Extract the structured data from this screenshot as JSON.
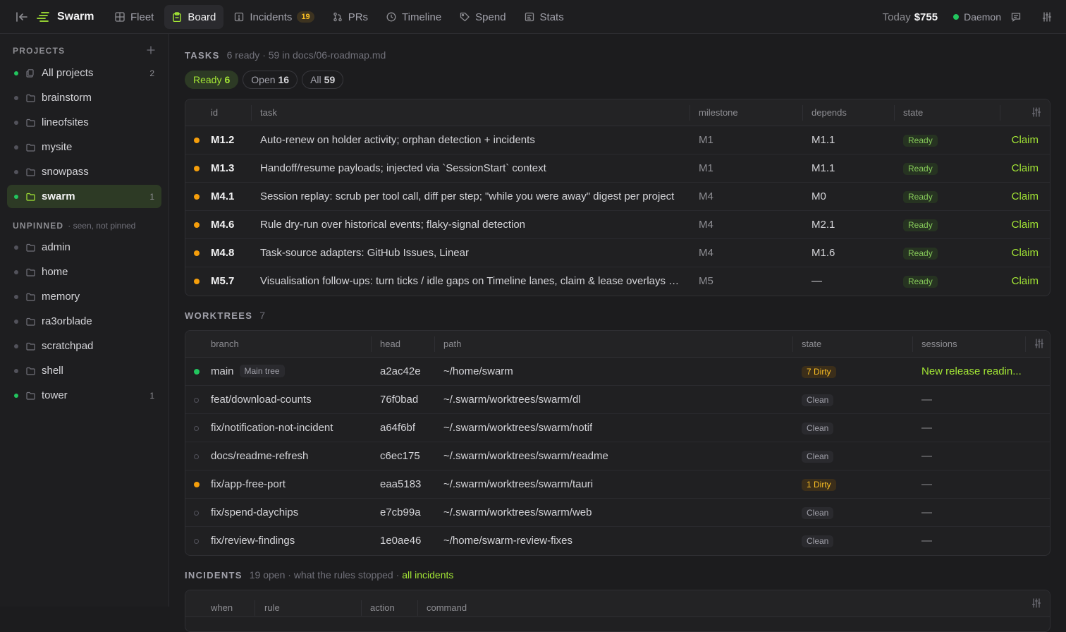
{
  "app": {
    "name": "Swarm"
  },
  "nav": [
    {
      "label": "Fleet",
      "icon": "grid-icon"
    },
    {
      "label": "Board",
      "icon": "clipboard-icon",
      "active": true
    },
    {
      "label": "Incidents",
      "icon": "alert-square-icon",
      "badge": "19"
    },
    {
      "label": "PRs",
      "icon": "pull-request-icon"
    },
    {
      "label": "Timeline",
      "icon": "clock-icon"
    },
    {
      "label": "Spend",
      "icon": "tag-icon"
    },
    {
      "label": "Stats",
      "icon": "stats-icon"
    }
  ],
  "topbar": {
    "today_label": "Today",
    "today_value": "$755",
    "daemon_label": "Daemon",
    "daemon_color": "#22c55e"
  },
  "sidebar": {
    "projects_title": "PROJECTS",
    "projects": [
      {
        "name": "All projects",
        "count": "2",
        "status": "green"
      },
      {
        "name": "brainstorm",
        "count": "",
        "status": "gray"
      },
      {
        "name": "lineofsites",
        "count": "",
        "status": "gray"
      },
      {
        "name": "mysite",
        "count": "",
        "status": "gray"
      },
      {
        "name": "snowpass",
        "count": "",
        "status": "gray"
      },
      {
        "name": "swarm",
        "count": "1",
        "status": "green",
        "active": true
      }
    ],
    "unpinned_title": "UNPINNED",
    "unpinned_sub": "· seen, not pinned",
    "unpinned": [
      {
        "name": "admin",
        "count": "",
        "status": "gray"
      },
      {
        "name": "home",
        "count": "",
        "status": "gray"
      },
      {
        "name": "memory",
        "count": "",
        "status": "gray"
      },
      {
        "name": "ra3orblade",
        "count": "",
        "status": "gray"
      },
      {
        "name": "scratchpad",
        "count": "",
        "status": "gray"
      },
      {
        "name": "shell",
        "count": "",
        "status": "gray"
      },
      {
        "name": "tower",
        "count": "1",
        "status": "green"
      }
    ]
  },
  "tasks": {
    "title": "TASKS",
    "subtitle": "6 ready · 59 in docs/06-roadmap.md",
    "filters": [
      {
        "label": "Ready",
        "count": "6",
        "active": true
      },
      {
        "label": "Open",
        "count": "16"
      },
      {
        "label": "All",
        "count": "59"
      }
    ],
    "columns": {
      "id": "id",
      "task": "task",
      "milestone": "milestone",
      "depends": "depends",
      "state": "state"
    },
    "rows": [
      {
        "id": "M1.2",
        "task": "Auto-renew on holder activity; orphan detection + incidents",
        "milestone": "M1",
        "depends": "M1.1",
        "state": "Ready",
        "action": "Claim"
      },
      {
        "id": "M1.3",
        "task": "Handoff/resume payloads; injected via `SessionStart` context",
        "milestone": "M1",
        "depends": "M1.1",
        "state": "Ready",
        "action": "Claim"
      },
      {
        "id": "M4.1",
        "task": "Session replay: scrub per tool call, diff per step; \"while you were away\" digest per project",
        "milestone": "M4",
        "depends": "M0",
        "state": "Ready",
        "action": "Claim"
      },
      {
        "id": "M4.6",
        "task": "Rule dry-run over historical events; flaky-signal detection",
        "milestone": "M4",
        "depends": "M2.1",
        "state": "Ready",
        "action": "Claim"
      },
      {
        "id": "M4.8",
        "task": "Task-source adapters: GitHub Issues, Linear",
        "milestone": "M4",
        "depends": "M1.6",
        "state": "Ready",
        "action": "Claim"
      },
      {
        "id": "M5.7",
        "task": "Visualisation follow-ups: turn ticks / idle gaps on Timeline lanes, claim & lease overlays onc...",
        "milestone": "M5",
        "depends": "—",
        "state": "Ready",
        "action": "Claim"
      }
    ]
  },
  "worktrees": {
    "title": "WORKTREES",
    "subtitle": "7",
    "columns": {
      "branch": "branch",
      "head": "head",
      "path": "path",
      "state": "state",
      "sessions": "sessions"
    },
    "rows": [
      {
        "branch": "main",
        "tag": "Main tree",
        "head": "a2ac42e",
        "path": "~/home/swarm",
        "state": "7 Dirty",
        "state_kind": "dirty",
        "sessions": "New release readin...",
        "dot": "green"
      },
      {
        "branch": "feat/download-counts",
        "tag": "",
        "head": "76f0bad",
        "path": "~/.swarm/worktrees/swarm/dl",
        "state": "Clean",
        "state_kind": "clean",
        "sessions": "—",
        "dot": "hollow"
      },
      {
        "branch": "fix/notification-not-incident",
        "tag": "",
        "head": "a64f6bf",
        "path": "~/.swarm/worktrees/swarm/notif",
        "state": "Clean",
        "state_kind": "clean",
        "sessions": "—",
        "dot": "hollow"
      },
      {
        "branch": "docs/readme-refresh",
        "tag": "",
        "head": "c6ec175",
        "path": "~/.swarm/worktrees/swarm/readme",
        "state": "Clean",
        "state_kind": "clean",
        "sessions": "—",
        "dot": "hollow"
      },
      {
        "branch": "fix/app-free-port",
        "tag": "",
        "head": "eaa5183",
        "path": "~/.swarm/worktrees/swarm/tauri",
        "state": "1 Dirty",
        "state_kind": "dirty",
        "sessions": "—",
        "dot": "amber"
      },
      {
        "branch": "fix/spend-daychips",
        "tag": "",
        "head": "e7cb99a",
        "path": "~/.swarm/worktrees/swarm/web",
        "state": "Clean",
        "state_kind": "clean",
        "sessions": "—",
        "dot": "hollow"
      },
      {
        "branch": "fix/review-findings",
        "tag": "",
        "head": "1e0ae46",
        "path": "~/home/swarm-review-fixes",
        "state": "Clean",
        "state_kind": "clean",
        "sessions": "—",
        "dot": "hollow"
      }
    ]
  },
  "incidents": {
    "title": "INCIDENTS",
    "subtitle": "19 open · what the rules stopped ·",
    "link": "all incidents",
    "columns": {
      "when": "when",
      "rule": "rule",
      "action": "action",
      "command": "command"
    }
  }
}
